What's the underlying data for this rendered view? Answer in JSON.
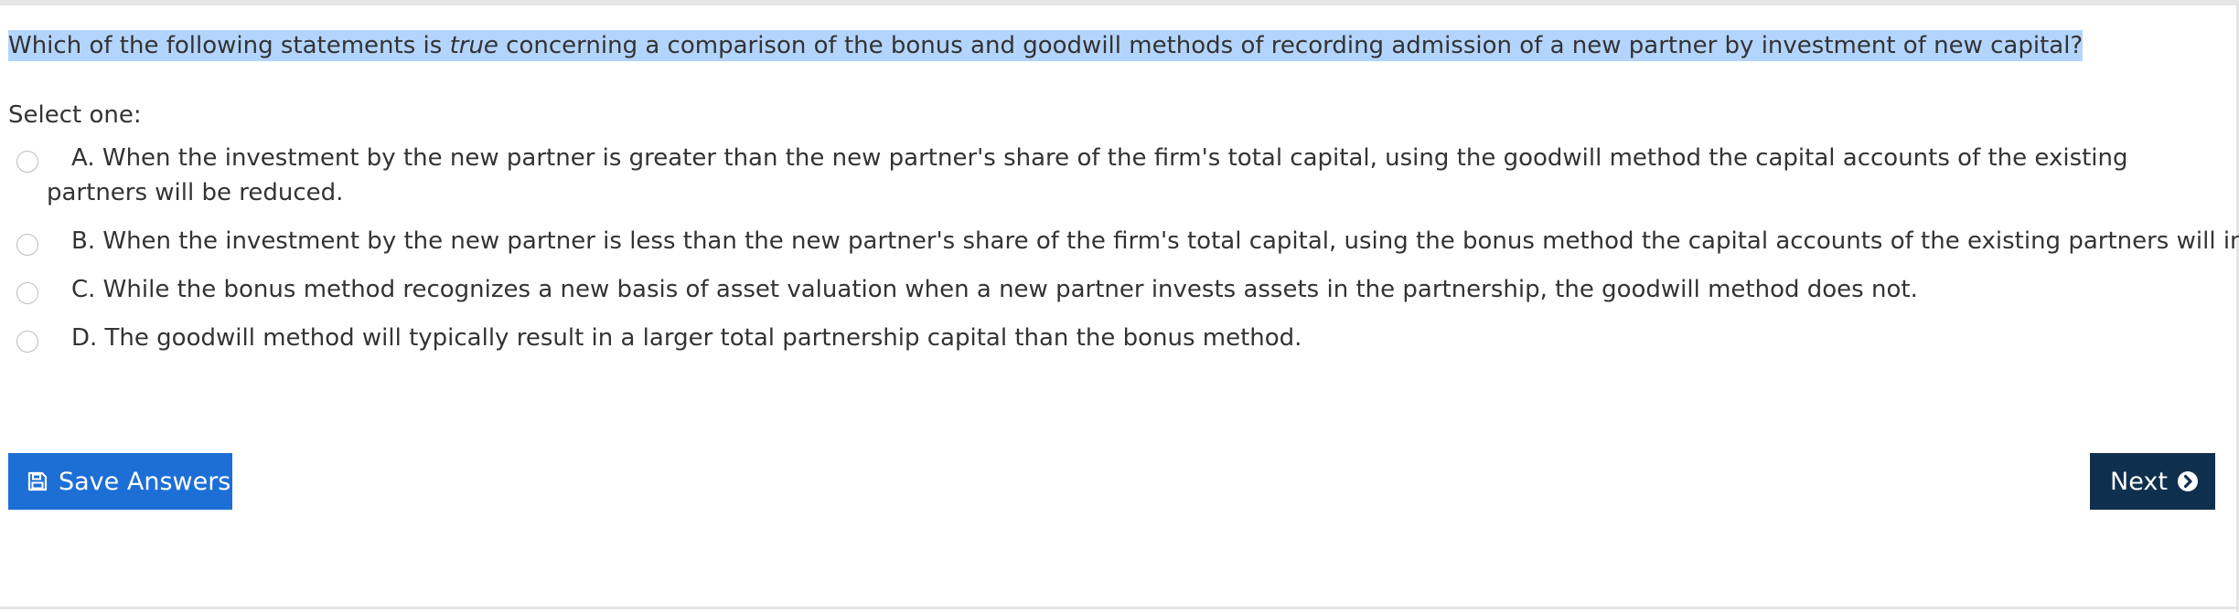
{
  "question": {
    "text_before": "Which of the following statements is ",
    "emphasis": "true",
    "text_after": " concerning a comparison of the bonus and goodwill methods of recording admission of a new partner by investment of new capital?",
    "highlighted": true
  },
  "prompt": "Select one:",
  "options": [
    {
      "text": "A. When the investment by the new partner is greater than the new partner's share of the firm's total capital, using the goodwill method the capital accounts of the existing partners will be reduced.",
      "selected": false
    },
    {
      "text": "B. When the investment by the new partner is less than the new partner's share of the firm's total capital, using the bonus method the capital accounts of the existing partners will increase.",
      "selected": false
    },
    {
      "text": "C. While the bonus method recognizes a new basis of asset valuation when a new partner invests assets in the partnership, the goodwill method does not.",
      "selected": false
    },
    {
      "text": "D. The goodwill method will typically result in a larger total partnership capital than the bonus method.",
      "selected": false
    }
  ],
  "buttons": {
    "save_label": "Save Answers",
    "save_icon": "floppy-disk-icon",
    "next_label": "Next",
    "next_icon": "chevron-circle-right-icon"
  },
  "colors": {
    "highlight": "#b3d4fc",
    "save_button": "#1d6fd6",
    "next_button": "#0f2f4f",
    "text": "#333333"
  }
}
